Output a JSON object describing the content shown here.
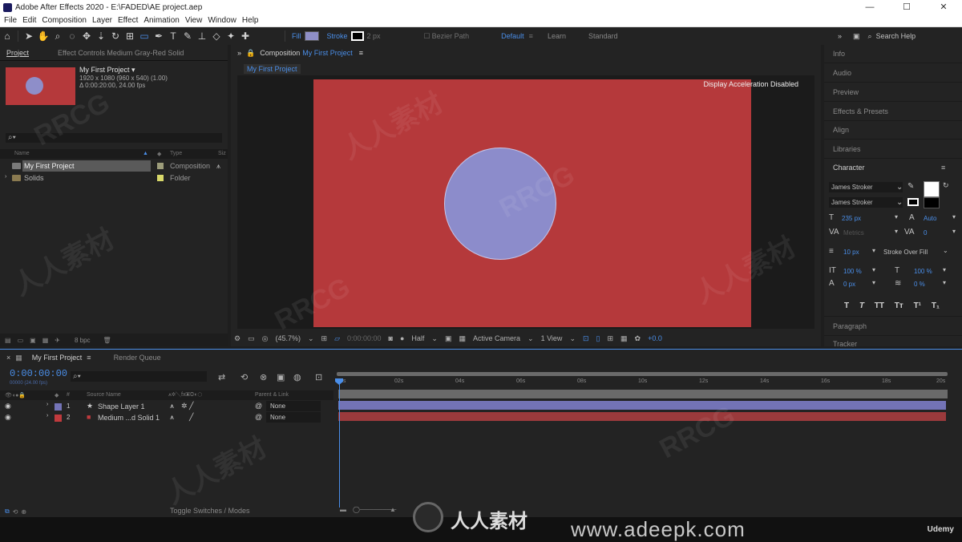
{
  "app": {
    "title": "Adobe After Effects 2020 - E:\\FADED\\AE project.aep",
    "win_min": "—",
    "win_max": "☐",
    "win_close": "✕"
  },
  "menu": [
    "File",
    "Edit",
    "Composition",
    "Layer",
    "Effect",
    "Animation",
    "View",
    "Window",
    "Help"
  ],
  "toolbar": {
    "fill_label": "Fill",
    "stroke_label": "Stroke",
    "stroke_width": "2 px",
    "bezier_label": "Bezier Path",
    "workspaces": [
      "Default",
      "Learn",
      "Standard"
    ],
    "active_workspace": "Default",
    "search_help": "Search Help",
    "fill_color": "#8f8fc7",
    "stroke_color": "#ffffff"
  },
  "project_panel": {
    "tab_project": "Project",
    "tab_effects": "Effect Controls Medium Gray-Red Solid",
    "comp_name": "My First Project ▾",
    "comp_meta1": "1920 x 1080  (960 x 540) (1.00)",
    "comp_meta2": "Δ 0:00:20:00, 24.00 fps",
    "search_icon": "⌕▾",
    "col_name": "Name",
    "col_type": "Type",
    "col_size": "Siz",
    "items": [
      {
        "name": "My First Project",
        "type": "Composition",
        "label_color": "#9c9c7a",
        "selected": true
      },
      {
        "name": "Solids",
        "type": "Folder",
        "label_color": "#d8d86a",
        "selected": false
      }
    ],
    "bpc": "8 bpc"
  },
  "comp_panel": {
    "tab_prefix": "Composition",
    "tab_name": "My First Project",
    "breadcrumb": "My First Project",
    "accel_note": "Display Acceleration Disabled",
    "zoom": "(45.7%)",
    "timecode": "0:00:00:00",
    "resolution": "Half",
    "camera": "Active Camera",
    "views": "1 View",
    "exposure": "+0.0",
    "bg_color": "#b5393b",
    "circle_color": "#8c8ccb"
  },
  "right_panel": {
    "items": [
      "Info",
      "Audio",
      "Preview",
      "Effects & Presets",
      "Align",
      "Libraries"
    ],
    "character_title": "Character",
    "font_family": "James Stroker",
    "font_style": "James Stroker",
    "font_size": "235 px",
    "leading": "Auto",
    "kerning": "Metrics",
    "tracking": "0",
    "stroke_width": "10 px",
    "stroke_mode": "Stroke Over Fill",
    "vert_scale": "100 %",
    "horiz_scale": "100 %",
    "baseline": "0 px",
    "tsume": "0 %",
    "paragraph": "Paragraph",
    "tracker": "Tracker"
  },
  "timeline": {
    "tab_comp": "My First Project",
    "tab_render": "Render Queue",
    "timecode": "0:00:00:00",
    "frame_sub": "00000 (24.00 fps)",
    "col_source": "Source Name",
    "col_parent": "Parent & Link",
    "col_num": "#",
    "ruler_ticks": [
      "0s",
      "02s",
      "04s",
      "06s",
      "08s",
      "10s",
      "12s",
      "14s",
      "16s",
      "18s",
      "20s"
    ],
    "layers": [
      {
        "num": "1",
        "name": "Shape Layer 1",
        "label_color": "#7373b6",
        "parent": "None"
      },
      {
        "num": "2",
        "name": "Medium ...d Solid 1",
        "label_color": "#c03a3d",
        "parent": "None"
      }
    ],
    "toggle_label": "Toggle Switches / Modes"
  },
  "watermark": {
    "logo_text": "人人素材",
    "site": "www.adeepk.com",
    "udemy": "Udemy",
    "tiles": [
      "RRCG",
      "人人素材",
      "RRCG",
      "人人素材",
      "RRCG",
      "人人素材",
      "RRCG",
      "人人素材"
    ]
  }
}
